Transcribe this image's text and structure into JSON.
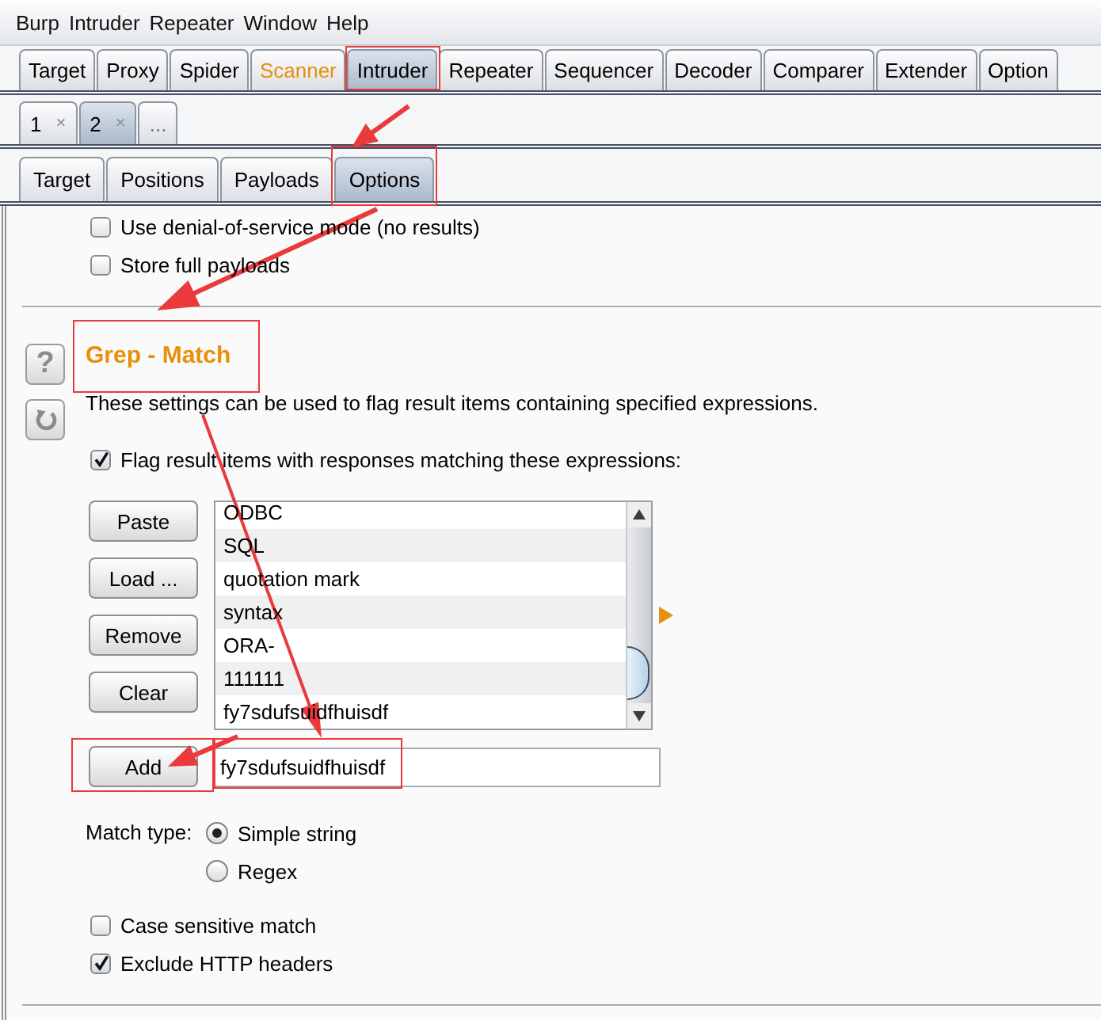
{
  "menu": [
    "Burp",
    "Intruder",
    "Repeater",
    "Window",
    "Help"
  ],
  "main_tabs": [
    {
      "label": "Target",
      "selected": false,
      "annotated": false,
      "color": "#000000"
    },
    {
      "label": "Proxy",
      "selected": false,
      "annotated": false,
      "color": "#000000"
    },
    {
      "label": "Spider",
      "selected": false,
      "annotated": false,
      "color": "#000000"
    },
    {
      "label": "Scanner",
      "selected": false,
      "annotated": false,
      "color": "#e8900c"
    },
    {
      "label": "Intruder",
      "selected": true,
      "annotated": true,
      "color": "#000000"
    },
    {
      "label": "Repeater",
      "selected": false,
      "annotated": false,
      "color": "#000000"
    },
    {
      "label": "Sequencer",
      "selected": false,
      "annotated": false,
      "color": "#000000"
    },
    {
      "label": "Decoder",
      "selected": false,
      "annotated": false,
      "color": "#000000"
    },
    {
      "label": "Comparer",
      "selected": false,
      "annotated": false,
      "color": "#000000"
    },
    {
      "label": "Extender",
      "selected": false,
      "annotated": false,
      "color": "#000000"
    },
    {
      "label": "Option",
      "selected": false,
      "annotated": false,
      "color": "#000000"
    }
  ],
  "instance_tabs": [
    {
      "label": "1",
      "close": "×",
      "selected": false
    },
    {
      "label": "2",
      "close": "×",
      "selected": true
    },
    {
      "label": "...",
      "selected": false
    }
  ],
  "sub_tabs": [
    {
      "label": "Target",
      "selected": false,
      "annotated": false
    },
    {
      "label": "Positions",
      "selected": false,
      "annotated": false
    },
    {
      "label": "Payloads",
      "selected": false,
      "annotated": false
    },
    {
      "label": "Options",
      "selected": true,
      "annotated": true
    }
  ],
  "options_top": [
    {
      "label": "Use denial-of-service mode (no results)",
      "checked": false
    },
    {
      "label": "Store full payloads",
      "checked": false
    }
  ],
  "grep_match": {
    "help_button": "?",
    "title": "Grep - Match",
    "title_annotated": true,
    "description": "These settings can be used to flag result items containing specified expressions.",
    "flag_option": {
      "label": "Flag result items with responses matching these expressions:",
      "checked": true
    },
    "list_buttons": [
      "Paste",
      "Load ...",
      "Remove",
      "Clear"
    ],
    "expressions": [
      "ODBC",
      "SQL",
      "quotation mark",
      "syntax",
      "ORA-",
      "111111",
      "fy7sdufsuidfhuisdf"
    ],
    "add_button": {
      "label": "Add",
      "annotated": true
    },
    "add_field": {
      "value": "fy7sdufsuidfhuisdf",
      "annotated": true
    },
    "match_type": {
      "label": "Match type:",
      "options": [
        {
          "label": "Simple string",
          "selected": true
        },
        {
          "label": "Regex",
          "selected": false
        }
      ]
    },
    "options": [
      {
        "label": "Case sensitive match",
        "checked": false
      },
      {
        "label": "Exclude HTTP headers",
        "checked": true
      }
    ]
  },
  "annotation_arrows": true
}
